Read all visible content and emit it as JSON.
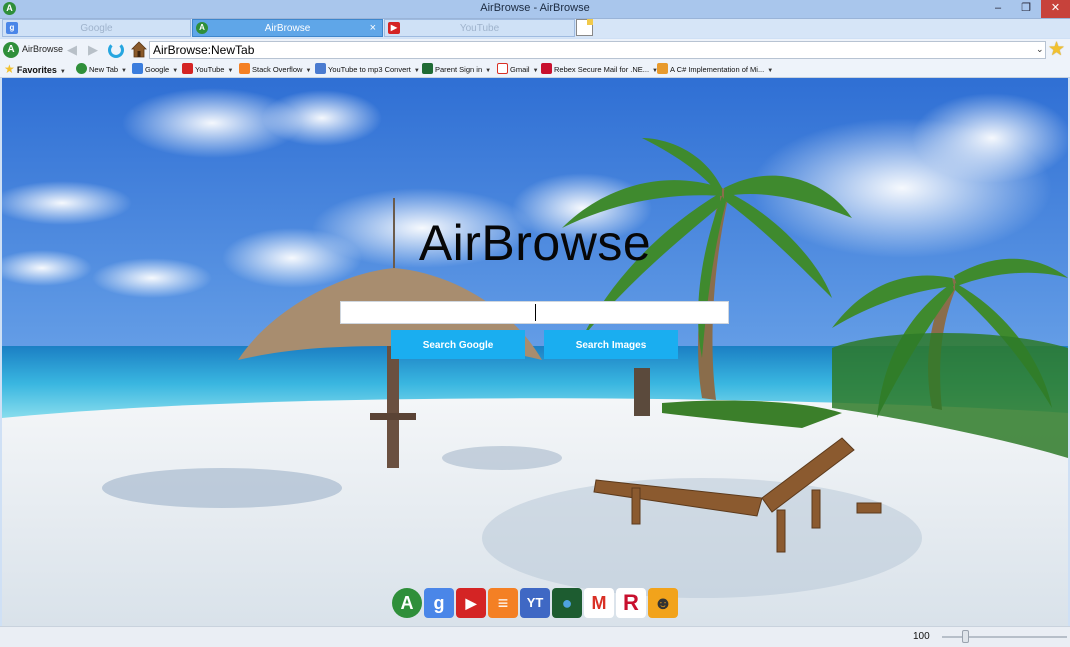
{
  "window": {
    "title": "AirBrowse - AirBrowse",
    "app_icon_letter": "A",
    "minimize": "‒",
    "restore": "❐",
    "close": "✕"
  },
  "tabs": [
    {
      "label": "Google",
      "icon": "google-icon",
      "active": false
    },
    {
      "label": "AirBrowse",
      "icon": "airbrowse-icon",
      "active": true,
      "close": "×"
    },
    {
      "label": "YouTube",
      "icon": "youtube-icon",
      "active": false
    }
  ],
  "nav": {
    "app_name": "AirBrowse",
    "logo_letter": "A",
    "back": "◀",
    "forward": "▶",
    "address": "AirBrowse:NewTab",
    "dropdown": "⌄",
    "star": "★"
  },
  "favorites": {
    "label": "Favorites",
    "items": [
      {
        "label": "New Tab",
        "icon": "airbrowse-icon",
        "color": "#2f8f3a"
      },
      {
        "label": "Google",
        "icon": "google-icon",
        "color": "#3b7ddd"
      },
      {
        "label": "YouTube",
        "icon": "youtube-icon",
        "color": "#d42424"
      },
      {
        "label": "Stack Overflow",
        "icon": "stackoverflow-icon",
        "color": "#f48024"
      },
      {
        "label": "YouTube to mp3 Convert",
        "icon": "ytmp3-icon",
        "color": "#4a7bd0"
      },
      {
        "label": "Parent Sign in",
        "icon": "parent-signin-icon",
        "color": "#1f6b35"
      },
      {
        "label": "Gmail",
        "icon": "gmail-icon",
        "color": "#d93025"
      },
      {
        "label": "Rebex Secure Mail for .NE...",
        "icon": "rebex-icon",
        "color": "#c8102e"
      },
      {
        "label": "A C# Implementation of Mi...",
        "icon": "codeproject-icon",
        "color": "#e89a2c"
      }
    ]
  },
  "content": {
    "title": "AirBrowse",
    "search_value": "",
    "search_google": "Search Google",
    "search_images": "Search Images",
    "dock": [
      {
        "icon": "airbrowse-icon",
        "letter": "A",
        "color": "#2f8f3a"
      },
      {
        "icon": "google-icon",
        "letter": "g",
        "color": "#4a86e8"
      },
      {
        "icon": "youtube-icon",
        "letter": "▶",
        "color": "#d42424"
      },
      {
        "icon": "stackoverflow-icon",
        "letter": "≡",
        "color": "#f48024"
      },
      {
        "icon": "ytmp3-icon",
        "letter": "YT",
        "color": "#3f68c4"
      },
      {
        "icon": "parent-signin-icon",
        "letter": "●",
        "color": "#1d5c30"
      },
      {
        "icon": "gmail-icon",
        "letter": "M",
        "color": "#ffffff"
      },
      {
        "icon": "rebex-icon",
        "letter": "R",
        "color": "#c8102e"
      },
      {
        "icon": "codeproject-icon",
        "letter": "☻",
        "color": "#f2a31b"
      }
    ]
  },
  "status": {
    "zoom": "100",
    "zoom_fraction": 0.16
  }
}
